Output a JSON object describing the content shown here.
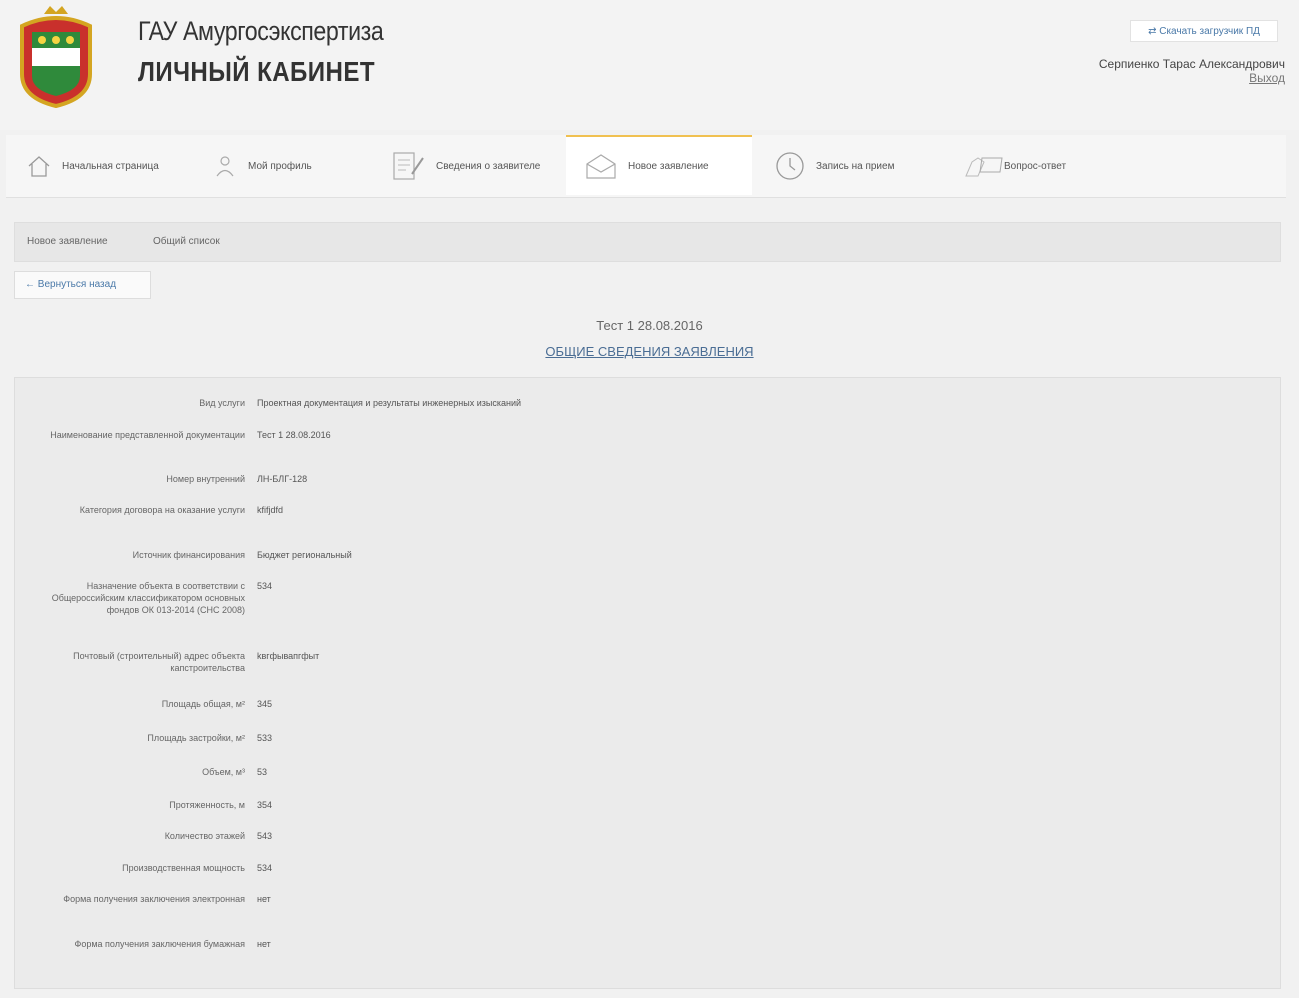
{
  "header": {
    "org_title": "ГАУ Амургосэкспертиза",
    "cabinet_title": "ЛИЧНЫЙ КАБИНЕТ",
    "download_button": "Скачать загрузчик ПД",
    "user_name": "Серпиенко Тарас Александрович",
    "logout": "Выход"
  },
  "nav": {
    "items": [
      {
        "label": "Начальная страница",
        "icon": "home-icon"
      },
      {
        "label": "Мой профиль",
        "icon": "profile-icon"
      },
      {
        "label": "Сведения о заявителе",
        "icon": "edit-document-icon"
      },
      {
        "label": "Новое заявление",
        "icon": "envelope-icon"
      },
      {
        "label": "Запись на прием",
        "icon": "clock-icon"
      },
      {
        "label": "Вопрос-ответ",
        "icon": "question-answer-icon"
      }
    ],
    "active_index": 3,
    "accent_color": "#f0c050"
  },
  "subnav": {
    "tabs": [
      "Новое заявление",
      "Общий список"
    ]
  },
  "back_button": "← Вернуться назад",
  "document": {
    "title": "Тест 1 28.08.2016",
    "section_link": "ОБЩИЕ СВЕДЕНИЯ ЗАЯВЛЕНИЯ"
  },
  "details": [
    {
      "label": "Вид услуги",
      "value": "Проектная документация и результаты инженерных изысканий"
    },
    {
      "label": "Наименование представленной документации",
      "value": "Тест 1 28.08.2016"
    },
    {
      "label": "Номер внутренний",
      "value": "ЛН-БЛГ-128"
    },
    {
      "label": "Категория договора на оказание услуги",
      "value": "kfifjdfd"
    },
    {
      "label": "Источник финансирования",
      "value": "Бюджет региональный"
    },
    {
      "label": "Назначение объекта в соответствии с Общероссийским классификатором основных фондов ОК 013-2014 (СНС 2008)",
      "value": "534"
    },
    {
      "label": "Почтовый (строительный) адрес объекта капстроительства",
      "value": "kвгфывапгфыт"
    },
    {
      "label": "Площадь общая, м²",
      "value": "345"
    },
    {
      "label": "Площадь застройки, м²",
      "value": "533"
    },
    {
      "label": "Объем, м³",
      "value": "53"
    },
    {
      "label": "Протяженность, м",
      "value": "354"
    },
    {
      "label": "Количество этажей",
      "value": "543"
    },
    {
      "label": "Производственная мощность",
      "value": "534"
    },
    {
      "label": "Форма получения заключения электронная",
      "value": "нет"
    },
    {
      "label": "Форма получения заключения бумажная",
      "value": "нет"
    }
  ]
}
